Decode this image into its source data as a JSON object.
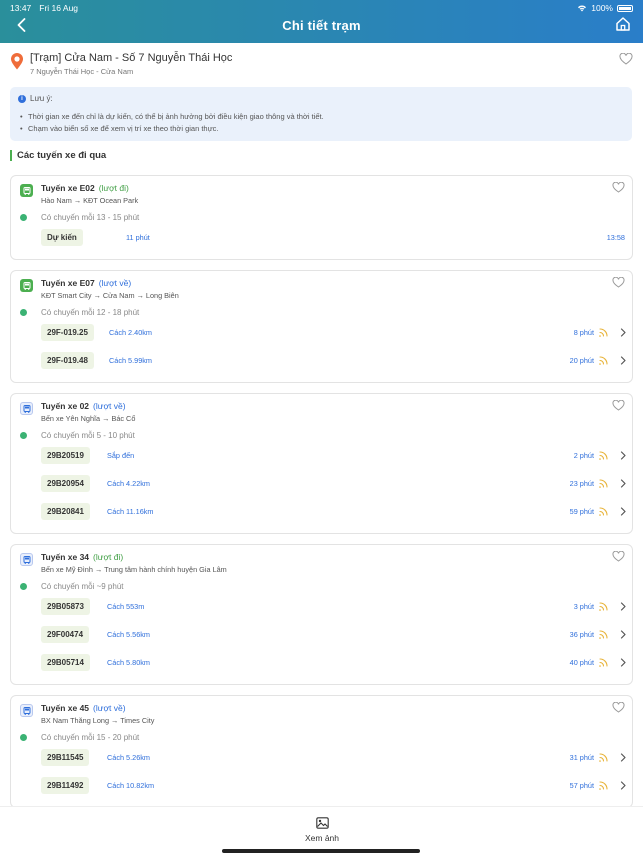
{
  "status_bar": {
    "time": "13:47",
    "date": "Fri 16 Aug",
    "battery": "100%"
  },
  "header": {
    "title": "Chi tiết trạm"
  },
  "station": {
    "name": "[Trạm] Cửa Nam - Số 7 Nguyễn Thái Học",
    "address": "7 Nguyễn Thái Học - Cửa Nam"
  },
  "note": {
    "title": "Lưu ý:",
    "lines": [
      "Thời gian xe đến chỉ là dự kiến, có thể bị ảnh hưởng bởi điều kiện giao thông và thời tiết.",
      "Chạm vào biển số xe để xem vị trí xe theo thời gian thực."
    ]
  },
  "section_title": "Các tuyến xe đi qua",
  "routes": [
    {
      "name": "Tuyến xe E02",
      "direction": "(lượt đi)",
      "path": "Hào Nam → KĐT Ocean Park",
      "frequency": "Có chuyến mỗi 13 - 15 phút",
      "icon_color": "green",
      "dir_color": "green",
      "vehicles": [
        {
          "plate": "Dự kiến",
          "info": "11 phút",
          "eta": "13:58"
        }
      ]
    },
    {
      "name": "Tuyến xe E07",
      "direction": "(lượt về)",
      "path": "KĐT Smart City → Cửa Nam → Long Biên",
      "frequency": "Có chuyến mỗi 12 - 18 phút",
      "icon_color": "green",
      "dir_color": "blue",
      "vehicles": [
        {
          "plate": "29F-019.25",
          "info": "Cách 2.40km",
          "eta": "8 phút"
        },
        {
          "plate": "29F-019.48",
          "info": "Cách 5.99km",
          "eta": "20 phút"
        }
      ]
    },
    {
      "name": "Tuyến xe 02",
      "direction": "(lượt về)",
      "path": "Bến xe Yên Nghĩa → Bác Cổ",
      "frequency": "Có chuyến mỗi 5 - 10 phút",
      "icon_color": "blue",
      "dir_color": "blue",
      "vehicles": [
        {
          "plate": "29B20519",
          "info": "Sắp đến",
          "eta": "2 phút"
        },
        {
          "plate": "29B20954",
          "info": "Cách 4.22km",
          "eta": "23 phút"
        },
        {
          "plate": "29B20841",
          "info": "Cách 11.16km",
          "eta": "59 phút"
        }
      ]
    },
    {
      "name": "Tuyến xe 34",
      "direction": "(lượt đi)",
      "path": "Bến xe Mỹ Đình → Trung tâm hành chính huyện Gia Lâm",
      "frequency": "Có chuyến mỗi ~9 phút",
      "icon_color": "blue",
      "dir_color": "green",
      "vehicles": [
        {
          "plate": "29B05873",
          "info": "Cách 553m",
          "eta": "3 phút"
        },
        {
          "plate": "29F00474",
          "info": "Cách 5.56km",
          "eta": "36 phút"
        },
        {
          "plate": "29B05714",
          "info": "Cách 5.80km",
          "eta": "40 phút"
        }
      ]
    },
    {
      "name": "Tuyến xe 45",
      "direction": "(lượt về)",
      "path": "BX Nam Thăng Long → Times City",
      "frequency": "Có chuyến mỗi 15 - 20 phút",
      "icon_color": "blue",
      "dir_color": "blue",
      "vehicles": [
        {
          "plate": "29B11545",
          "info": "Cách 5.26km",
          "eta": "31 phút"
        },
        {
          "plate": "29B11492",
          "info": "Cách 10.82km",
          "eta": "57 phút"
        }
      ]
    }
  ],
  "bottom": {
    "photo_label": "Xem ảnh"
  },
  "colors": {
    "accent_blue": "#2f6fdb",
    "accent_green": "#4caf50",
    "header_start": "#2a8f9b",
    "header_end": "#2a7ec9"
  }
}
